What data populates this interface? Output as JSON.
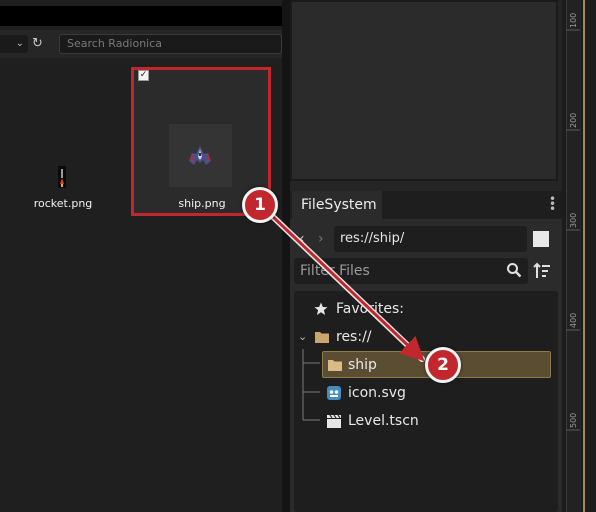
{
  "asset_panel": {
    "search_placeholder": "Search Radionica",
    "items": [
      {
        "label": "rocket.png"
      },
      {
        "label": "ship.png",
        "selected": true
      }
    ]
  },
  "filesystem": {
    "tab_label": "FileSystem",
    "path": "res://ship/",
    "filter_placeholder": "Filter Files",
    "tree": [
      {
        "label": "Favorites:",
        "icon": "star-icon"
      },
      {
        "label": "res://",
        "icon": "folder-icon"
      },
      {
        "label": "ship",
        "icon": "folder-icon",
        "selected": true
      },
      {
        "label": "icon.svg",
        "icon": "godot-icon"
      },
      {
        "label": "Level.tscn",
        "icon": "clapperboard-icon"
      }
    ]
  },
  "ruler_ticks": [
    "100",
    "200",
    "300",
    "400",
    "500"
  ],
  "annotations": [
    {
      "number": "1"
    },
    {
      "number": "2"
    }
  ],
  "colors": {
    "highlight_red": "#c1272d",
    "selection_bg": "#5a4d32",
    "folder": "#c9a66b"
  }
}
